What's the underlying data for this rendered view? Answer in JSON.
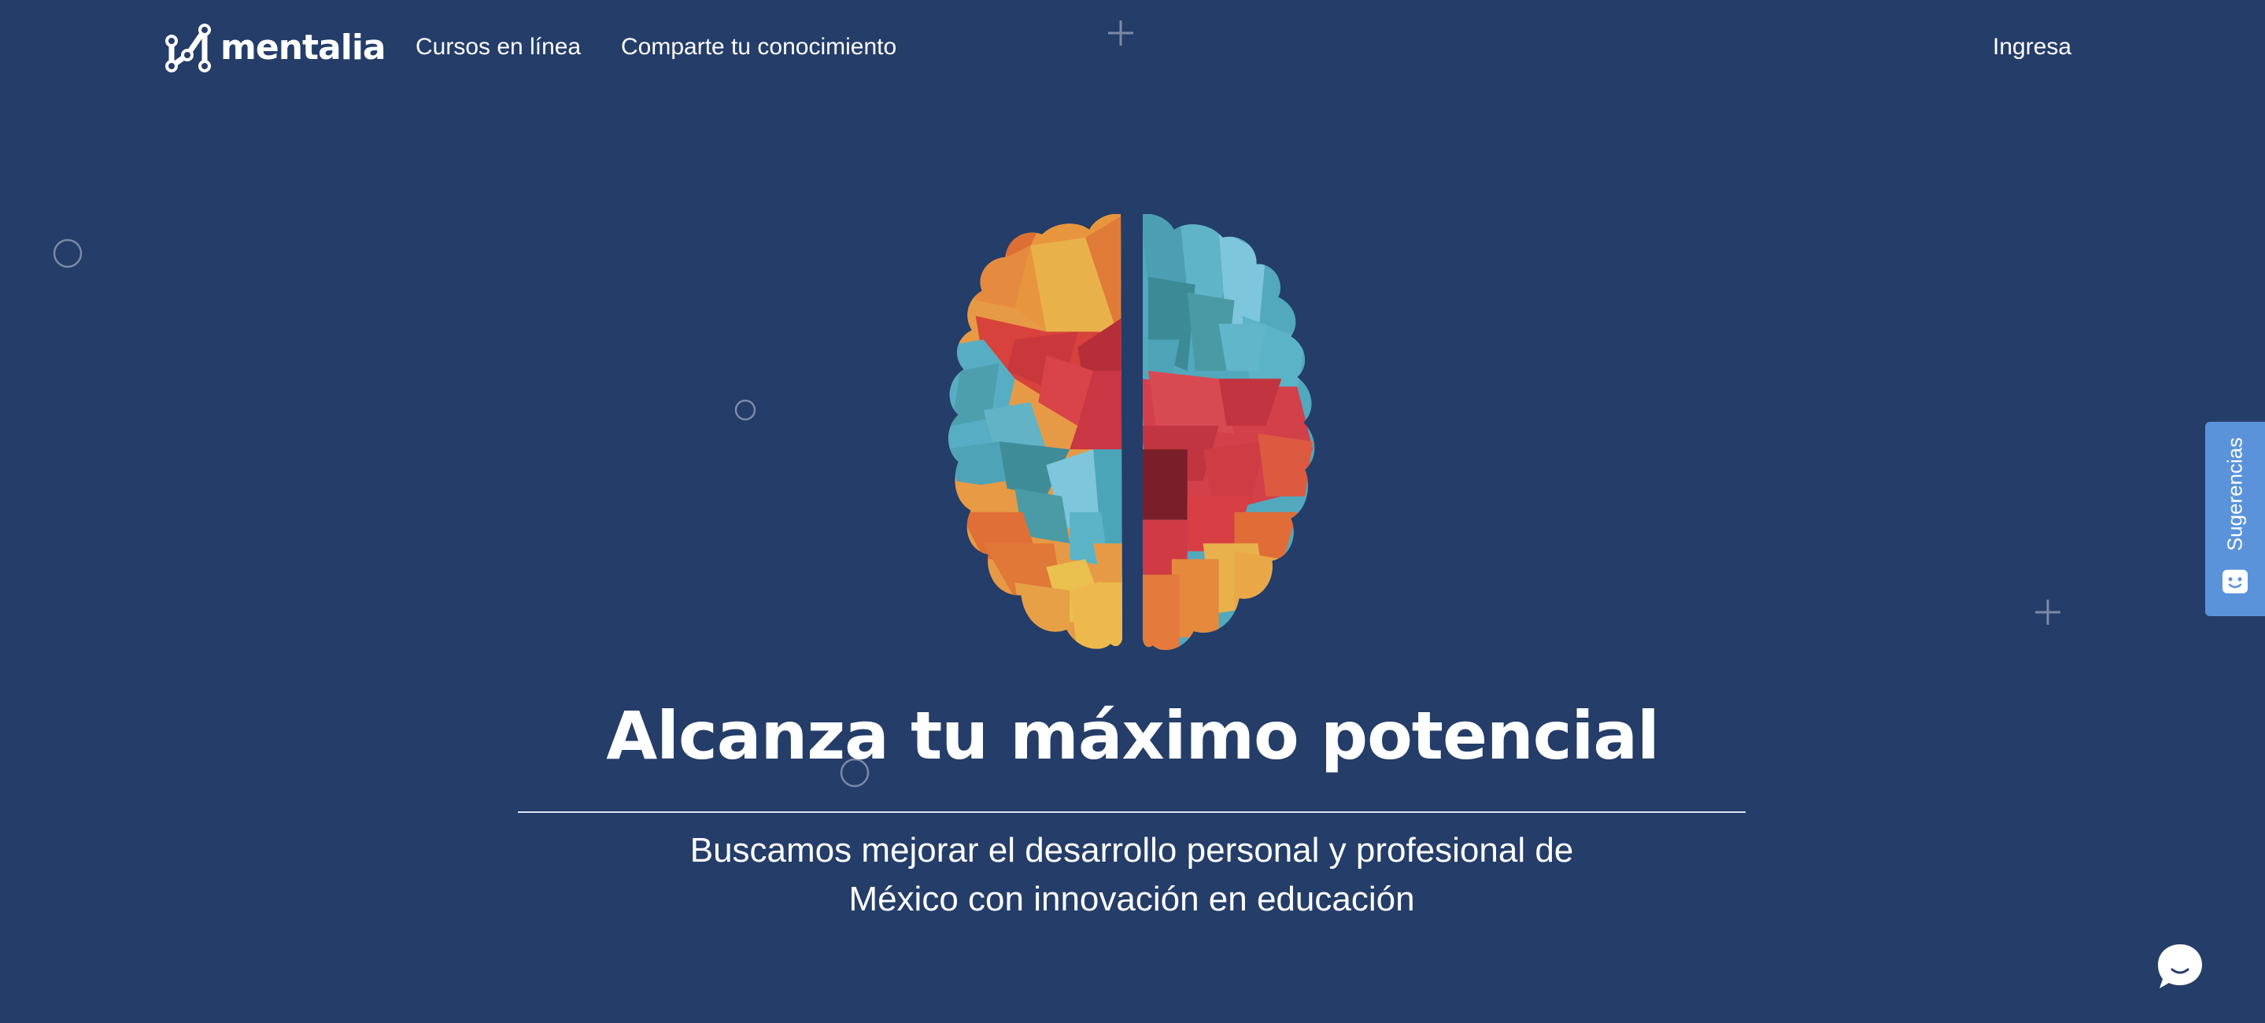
{
  "header": {
    "brand": "mentalia",
    "nav": {
      "courses": "Cursos en línea",
      "share": "Comparte tu conocimiento",
      "login": "Ingresa"
    }
  },
  "hero": {
    "title": "Alcanza tu máximo potencial",
    "subtitle": "Buscamos mejorar el desarrollo personal y profesional de México con innovación en educación"
  },
  "feedback": {
    "label": "Sugerencias",
    "icon": "chat-face-icon"
  },
  "chat": {
    "icon": "chat-bubble-icon"
  },
  "colors": {
    "background": "#243d69",
    "feedback_tab": "#5b93db",
    "text": "#ffffff"
  }
}
